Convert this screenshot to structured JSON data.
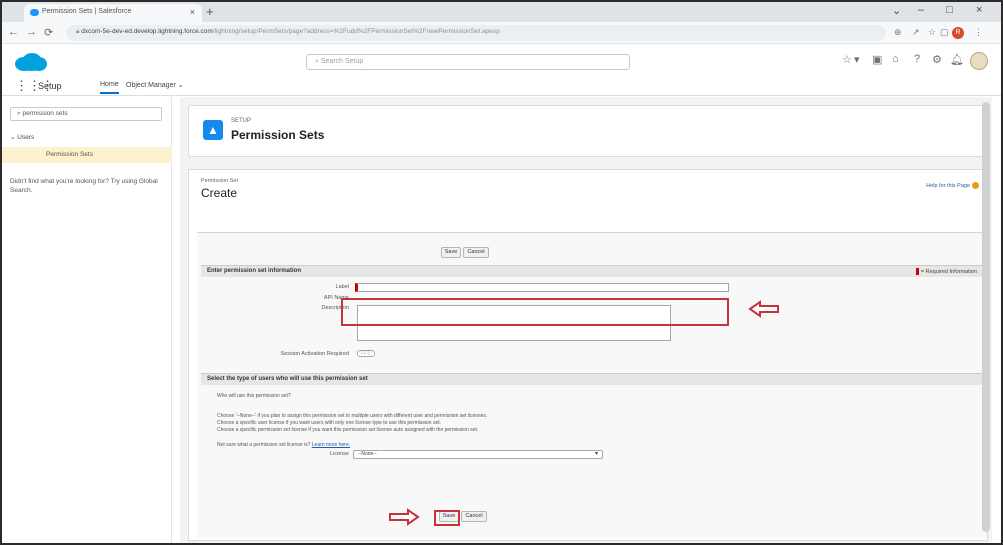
{
  "browser": {
    "tab_title": "Permission Sets | Salesforce",
    "tab_close": "×",
    "new_tab": "+",
    "window_controls": [
      "⌄",
      "–",
      "□",
      "×"
    ],
    "url_host": "dxcom-5e-dev-ed.develop.lightning.force.com",
    "url_path": "/lightning/setup/PermSets/page?address=%2Fudd%2FPermissionSet%2FnewPermissionSet.apexp",
    "profile_initial": "R"
  },
  "sf_header": {
    "search_placeholder": "Search Setup"
  },
  "navbar": {
    "app_name": "Setup",
    "tabs": [
      "Home",
      "Object Manager ⌄"
    ]
  },
  "sidebar": {
    "quick_find_value": "permission sets",
    "tree_group": "⌄ Users",
    "tree_item": "Permission Sets",
    "hint_text": "Didn't find what you're looking for? Try using Global Search."
  },
  "page_header": {
    "setup_label": "SETUP",
    "title": "Permission Sets"
  },
  "panel": {
    "breadcrumb": "Permission Set",
    "title": "Create",
    "help_link": "Help for this Page"
  },
  "form": {
    "top_buttons": [
      "Save",
      "Cancel"
    ],
    "section1_title": "Enter permission set information",
    "required_info": "= Required Information",
    "fields": {
      "label": "Label",
      "api_name": "API Name",
      "description": "Description",
      "session_activation": "Session Activation Required"
    },
    "session_toggle": "☐ ⓘ",
    "section2_title": "Select the type of users who will use this permission set",
    "question": "Who will use this permission set?",
    "choose_lines": [
      "Choose '--None--' if you plan to assign this permission set to multiple users with different user and permission set licenses.",
      "Choose a specific user license if you want users with only one license type to use this permission set.",
      "Choose a specific permission set license if you want this permission set license auto assigned with the permission set."
    ],
    "not_sure": "Not sure what a permission set license is?",
    "learn_more": "Learn more here.",
    "license_label": "License",
    "license_value": "--None--",
    "bottom_buttons": [
      "Save",
      "Cancel"
    ]
  },
  "colors": {
    "highlight": "#c8323a",
    "brand_blue": "#1589ee"
  }
}
